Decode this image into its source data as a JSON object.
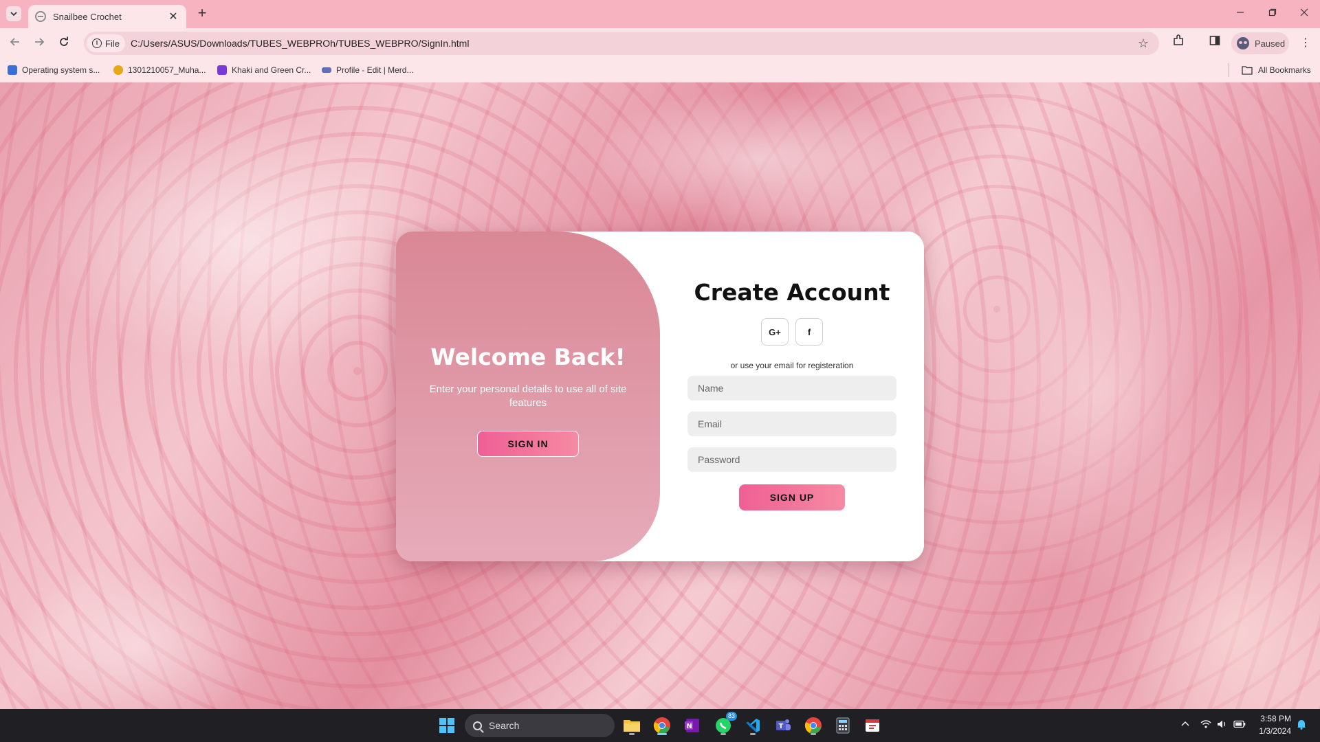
{
  "browser": {
    "tab_title": "Snailbee Crochet",
    "tab_close": "✕",
    "new_tab": "+",
    "url_chip": "File",
    "url": "C:/Users/ASUS/Downloads/TUBES_WEBPROh/TUBES_WEBPRO/SignIn.html",
    "profile_status": "Paused",
    "bookmarks": [
      {
        "label": "Operating system s...",
        "color": "#3b6fd8"
      },
      {
        "label": "1301210057_Muha...",
        "color": "#e6a817"
      },
      {
        "label": "Khaki and Green Cr...",
        "color": "#7a3ad6"
      },
      {
        "label": "Profile - Edit | Merd...",
        "color": "#5e6fb5"
      }
    ],
    "all_bookmarks": "All Bookmarks"
  },
  "left_panel": {
    "title": "Welcome Back!",
    "text": "Enter your personal details to use all of site features",
    "button": "SIGN IN"
  },
  "right_panel": {
    "title": "Create Account",
    "social_google": "G+",
    "social_facebook": "f",
    "hint": "or use your email for registeration",
    "name_placeholder": "Name",
    "email_placeholder": "Email",
    "password_placeholder": "Password",
    "button": "SIGN UP"
  },
  "taskbar": {
    "search": "Search",
    "whatsapp_badge": "83",
    "time": "3:58 PM",
    "date": "1/3/2024"
  },
  "colors": {
    "accent_gradient_start": "#ef5f94",
    "accent_gradient_end": "#f58aa2",
    "left_panel_top": "#d98795",
    "left_panel_bottom": "#e6abb9",
    "chrome_tab_bar": "#f8b3c1"
  }
}
